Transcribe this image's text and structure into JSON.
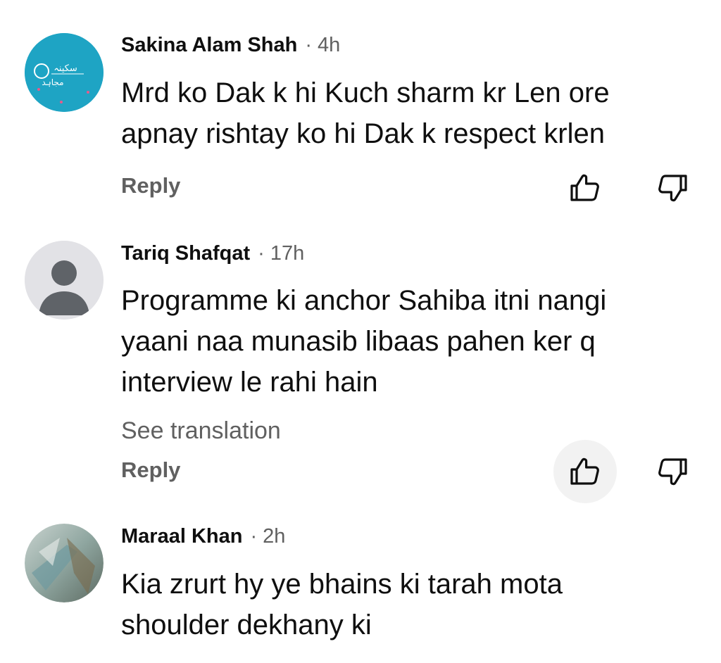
{
  "comments": [
    {
      "author": "Sakina Alam Shah",
      "separator": "·",
      "time": "4h",
      "text": "Mrd ko Dak k hi Kuch sharm kr Len ore\napnay rishtay ko hi Dak k respect krlen",
      "reply_label": "Reply",
      "avatar": {
        "type": "logo",
        "text_line1": "سکینہ",
        "text_line2": "مجاہد",
        "color": "#1ea4c4"
      },
      "like_icon": "thumbs-up-icon",
      "dislike_icon": "thumbs-down-icon"
    },
    {
      "author": "Tariq Shafqat",
      "separator": "·",
      "time": "17h",
      "text": "Programme ki anchor Sahiba itni nangi\nyaani naa munasib libaas pahen ker q\ninterview le rahi hain",
      "translate_label": "See translation",
      "reply_label": "Reply",
      "avatar": {
        "type": "default-person",
        "color": "#e2e2e6"
      },
      "like_icon": "thumbs-up-icon",
      "dislike_icon": "thumbs-down-icon"
    },
    {
      "author": "Maraal Khan",
      "separator": "·",
      "time": "2h",
      "text": "Kia zrurt hy ye bhains ki tarah mota\nshoulder dekhany ki",
      "avatar": {
        "type": "photo",
        "color": "#8fa6a0"
      }
    }
  ],
  "colors": {
    "primary_text": "#0f0f0f",
    "secondary_text": "#606060",
    "pressed_bg": "#f2f2f2"
  }
}
